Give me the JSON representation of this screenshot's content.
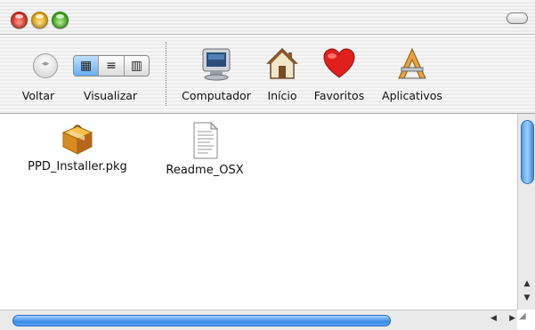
{
  "toolbar": {
    "back_label": "Voltar",
    "view_label": "Visualizar",
    "computer_label": "Computador",
    "home_label": "Início",
    "favorites_label": "Favoritos",
    "apps_label": "Aplicativos",
    "view_modes": [
      "icon-view",
      "list-view",
      "column-view"
    ],
    "active_view": "icon-view"
  },
  "files": [
    {
      "name": "PPD_Installer.pkg",
      "icon": "package-icon"
    },
    {
      "name": "Readme_OSX",
      "icon": "text-document-icon"
    }
  ],
  "colors": {
    "close": "#d8291a",
    "minimize": "#e0a000",
    "zoom": "#3aa51a",
    "scroll_thumb": "#3a8ae6"
  }
}
